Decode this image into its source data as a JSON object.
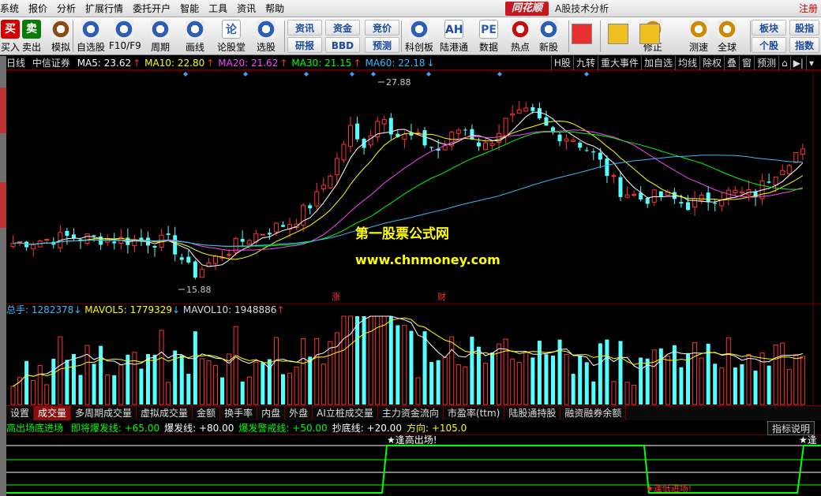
{
  "menu": {
    "items": [
      "系统",
      "报价",
      "分析",
      "扩展行情",
      "委托开户",
      "智能",
      "工具",
      "资讯",
      "帮助"
    ],
    "brand": "同花顺",
    "window_title": "A股技术分析",
    "register": "注册"
  },
  "toolbar": {
    "buttons": [
      {
        "label": "买入",
        "icon": "买",
        "color": "#d40000"
      },
      {
        "label": "卖出",
        "icon": "卖",
        "color": "#0a7a0a"
      },
      {
        "label": "模拟",
        "icon": "gavel-icon"
      },
      {
        "label": "自选股",
        "icon": "star-folder-icon"
      },
      {
        "label": "F10/F9",
        "icon": "doc-icon"
      },
      {
        "label": "周期",
        "icon": "clock-icon"
      },
      {
        "label": "画线",
        "icon": "pencil-icon"
      },
      {
        "label": "论股堂",
        "icon": "论"
      },
      {
        "label": "选股",
        "icon": "select-icon"
      },
      {
        "label": "科创板",
        "icon": "chip-icon"
      },
      {
        "label": "陆港通",
        "icon": "AH"
      },
      {
        "label": "数据",
        "icon": "PE"
      },
      {
        "label": "热点",
        "icon": "hot-icon"
      },
      {
        "label": "新股",
        "icon": "newstock-icon"
      },
      {
        "label": "修正",
        "icon": "refresh-icon"
      },
      {
        "label": "测速",
        "icon": "speed-icon"
      },
      {
        "label": "全球",
        "icon": "globe-icon"
      }
    ],
    "small": [
      "资讯",
      "研报",
      "资金",
      "BBD",
      "竞价",
      "预测",
      "板块",
      "个股",
      "股指",
      "指数"
    ]
  },
  "chart": {
    "period": "日线",
    "stock": "中信证券",
    "ma": [
      {
        "label": "MA5: 23.62",
        "color": "#ffffff"
      },
      {
        "label": "MA10: 22.80",
        "color": "#ffff00"
      },
      {
        "label": "MA20: 21.62",
        "color": "#ff44ff"
      },
      {
        "label": "MA30: 21.15",
        "color": "#00ff00"
      },
      {
        "label": "MA60: 22.18",
        "color": "#38b8ff"
      }
    ],
    "high_label": "27.88",
    "low_label": "15.88",
    "watermark1": "第一股票公式网",
    "watermark2": "www.chnmoney.com",
    "marker_zhang": "涨",
    "marker_cai": "财"
  },
  "right_tabs": [
    "H股",
    "九转",
    "重大事件",
    "加自选",
    "均线",
    "除权",
    "叠",
    "窗",
    "预测"
  ],
  "volume": {
    "total": "总手: 1282378",
    "mavol5": "MAVOL5: 1779329",
    "mavol10": "MAVOL10: 1948886"
  },
  "volume_tabs": [
    "设置",
    "成交量",
    "多周期成交量",
    "虚拟成交量",
    "金额",
    "换手率",
    "内盘",
    "外盘",
    "AI立桩成交量",
    "主力资金流向",
    "市盈率(ttm)",
    "陆股通持股",
    "融资融券余额"
  ],
  "indicator": {
    "name": "高出场底进场",
    "items": [
      {
        "label": "即将爆发线: +65.00",
        "color": "#00ff00"
      },
      {
        "label": "爆发线: +80.00",
        "color": "#ffffff"
      },
      {
        "label": "爆发警戒线: +50.00",
        "color": "#00ff00"
      },
      {
        "label": "抄底线: +20.00",
        "color": "#ffffff"
      },
      {
        "label": "方向: +105.0",
        "color": "#ffff00"
      }
    ],
    "explain": "指标说明",
    "annot_top": "★逢高出场!",
    "annot_bottom": "★逢低进场!",
    "annot_right": "★逢"
  },
  "chart_data": {
    "type": "candlestick",
    "title": "中信证券 日线",
    "ma_lines": [
      "MA5",
      "MA10",
      "MA20",
      "MA30",
      "MA60"
    ],
    "price_high": 27.88,
    "price_low": 15.88,
    "volume_last": 1282378,
    "mavol5": 1779329,
    "mavol10": 1948886,
    "indicator_lines": [
      65,
      80,
      50,
      20
    ],
    "direction": 105
  }
}
